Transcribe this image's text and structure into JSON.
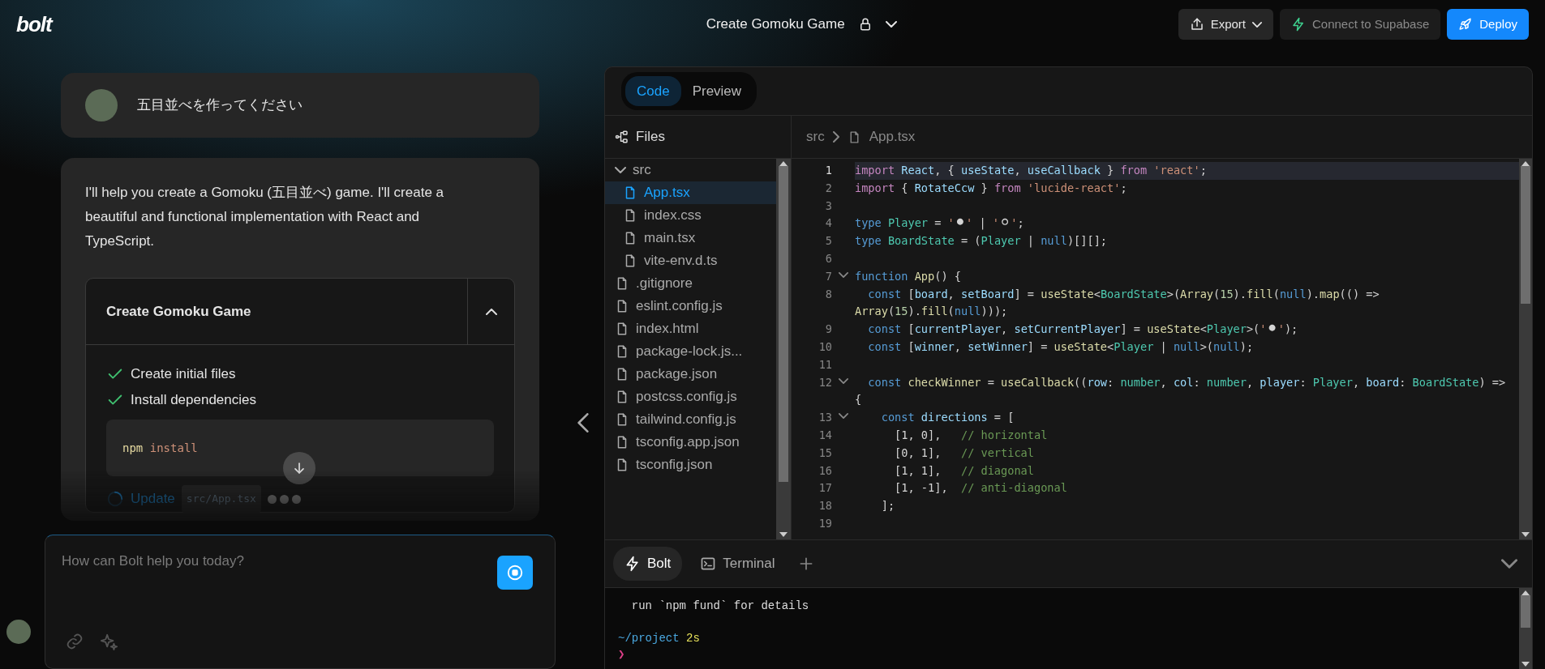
{
  "header": {
    "logo": "bolt",
    "title": "Create Gomoku Game",
    "buttons": [
      {
        "kind": "export",
        "label": "Export",
        "disabled": false
      },
      {
        "kind": "supabase",
        "label": "Connect to Supabase",
        "disabled": true
      },
      {
        "kind": "deploy",
        "label": "Deploy",
        "disabled": false
      }
    ]
  },
  "chat": {
    "messages": [
      {
        "kind": "user",
        "text": "五目並べを作ってください"
      },
      {
        "kind": "assistant",
        "text": "I'll help you create a Gomoku (五目並べ) game. I'll create a beautiful and functional implementation with React and TypeScript.",
        "artifact": {
          "title": "Create Gomoku Game",
          "expanded": true,
          "steps": [
            {
              "kind": "done",
              "label": "Create initial files"
            },
            {
              "kind": "done",
              "label": "Install dependencies",
              "command": [
                "npm",
                "install"
              ]
            },
            {
              "kind": "running",
              "label": "Update",
              "file": "src/App.tsx"
            }
          ]
        }
      }
    ],
    "input": {
      "placeholder": "How can Bolt help you today?"
    }
  },
  "editor": {
    "tabs": [
      {
        "label": "Code",
        "selected": true
      },
      {
        "label": "Preview",
        "selected": false
      }
    ],
    "files_title": "Files",
    "tree": [
      {
        "kind": "folder",
        "name": "src",
        "expanded": true,
        "selected": false,
        "children": [
          {
            "kind": "file",
            "name": "App.tsx",
            "selected": true
          },
          {
            "kind": "file",
            "name": "index.css",
            "selected": false
          },
          {
            "kind": "file",
            "name": "main.tsx",
            "selected": false
          },
          {
            "kind": "file",
            "name": "vite-env.d.ts",
            "selected": false
          }
        ]
      },
      {
        "kind": "file",
        "name": ".gitignore",
        "selected": false
      },
      {
        "kind": "file",
        "name": "eslint.config.js",
        "selected": false
      },
      {
        "kind": "file",
        "name": "index.html",
        "selected": false
      },
      {
        "kind": "file",
        "name": "package-lock.js...",
        "selected": false
      },
      {
        "kind": "file",
        "name": "package.json",
        "selected": false
      },
      {
        "kind": "file",
        "name": "postcss.config.js",
        "selected": false
      },
      {
        "kind": "file",
        "name": "tailwind.config.js",
        "selected": false
      },
      {
        "kind": "file",
        "name": "tsconfig.app.json",
        "selected": false
      },
      {
        "kind": "file",
        "name": "tsconfig.json",
        "selected": false
      }
    ],
    "breadcrumb": [
      "src",
      "App.tsx"
    ],
    "lines": [
      {
        "number": "1",
        "active": true,
        "foldable": false,
        "tokens": [
          {
            "kind": "control",
            "text": "import "
          },
          {
            "kind": "var",
            "text": "React"
          },
          {
            "kind": "plain",
            "text": ", { "
          },
          {
            "kind": "var",
            "text": "useState"
          },
          {
            "kind": "plain",
            "text": ", "
          },
          {
            "kind": "var",
            "text": "useCallback"
          },
          {
            "kind": "plain",
            "text": " } "
          },
          {
            "kind": "control",
            "text": "from "
          },
          {
            "kind": "string",
            "text": "'react'"
          },
          {
            "kind": "plain",
            "text": ";"
          }
        ]
      },
      {
        "number": "2",
        "active": false,
        "foldable": false,
        "tokens": [
          {
            "kind": "control",
            "text": "import"
          },
          {
            "kind": "plain",
            "text": " { "
          },
          {
            "kind": "var",
            "text": "RotateCcw"
          },
          {
            "kind": "plain",
            "text": " } "
          },
          {
            "kind": "control",
            "text": "from "
          },
          {
            "kind": "string",
            "text": "'lucide-react'"
          },
          {
            "kind": "plain",
            "text": ";"
          }
        ]
      },
      {
        "number": "3",
        "active": false,
        "foldable": false
      },
      {
        "number": "4",
        "active": false,
        "foldable": false,
        "tokens": [
          {
            "kind": "keyword",
            "text": "type "
          },
          {
            "kind": "type",
            "text": "Player"
          },
          {
            "kind": "plain",
            "text": " = "
          },
          {
            "kind": "string",
            "text": "'"
          },
          {
            "kind": "stone",
            "text": "⚫"
          },
          {
            "kind": "string",
            "text": "'"
          },
          {
            "kind": "plain",
            "text": " | "
          },
          {
            "kind": "string",
            "text": "'"
          },
          {
            "kind": "stone",
            "text": "⚪"
          },
          {
            "kind": "string",
            "text": "'"
          },
          {
            "kind": "plain",
            "text": ";"
          }
        ]
      },
      {
        "number": "5",
        "active": false,
        "foldable": false,
        "tokens": [
          {
            "kind": "keyword",
            "text": "type "
          },
          {
            "kind": "type",
            "text": "BoardState"
          },
          {
            "kind": "plain",
            "text": " = ("
          },
          {
            "kind": "type",
            "text": "Player"
          },
          {
            "kind": "plain",
            "text": " | "
          },
          {
            "kind": "keyword",
            "text": "null"
          },
          {
            "kind": "plain",
            "text": ")[][];"
          }
        ]
      },
      {
        "number": "6",
        "active": false,
        "foldable": false
      },
      {
        "number": "7",
        "active": false,
        "foldable": true,
        "tokens": [
          {
            "kind": "keyword",
            "text": "function "
          },
          {
            "kind": "func",
            "text": "App"
          },
          {
            "kind": "plain",
            "text": "() {"
          }
        ]
      },
      {
        "number": "8",
        "active": false,
        "foldable": false,
        "tokens": [
          {
            "kind": "keyword",
            "text": "  const"
          },
          {
            "kind": "plain",
            "text": " ["
          },
          {
            "kind": "var",
            "text": "board"
          },
          {
            "kind": "plain",
            "text": ", "
          },
          {
            "kind": "var",
            "text": "setBoard"
          },
          {
            "kind": "plain",
            "text": "] = "
          },
          {
            "kind": "func",
            "text": "useState"
          },
          {
            "kind": "plain",
            "text": "<"
          },
          {
            "kind": "type",
            "text": "BoardState"
          },
          {
            "kind": "plain",
            "text": ">("
          },
          {
            "kind": "func",
            "text": "Array"
          },
          {
            "kind": "plain",
            "text": "("
          },
          {
            "kind": "number",
            "text": "15"
          },
          {
            "kind": "plain",
            "text": ")."
          },
          {
            "kind": "func",
            "text": "fill"
          },
          {
            "kind": "plain",
            "text": "("
          },
          {
            "kind": "keyword",
            "text": "null"
          },
          {
            "kind": "plain",
            "text": ")."
          },
          {
            "kind": "func",
            "text": "map"
          },
          {
            "kind": "plain",
            "text": "(() =>"
          }
        ],
        "wrapped": [
          {
            "kind": "func",
            "text": "Array"
          },
          {
            "kind": "plain",
            "text": "("
          },
          {
            "kind": "number",
            "text": "15"
          },
          {
            "kind": "plain",
            "text": ")."
          },
          {
            "kind": "func",
            "text": "fill"
          },
          {
            "kind": "plain",
            "text": "("
          },
          {
            "kind": "keyword",
            "text": "null"
          },
          {
            "kind": "plain",
            "text": ")));"
          }
        ]
      },
      {
        "number": "9",
        "active": false,
        "foldable": false,
        "tokens": [
          {
            "kind": "keyword",
            "text": "  const"
          },
          {
            "kind": "plain",
            "text": " ["
          },
          {
            "kind": "var",
            "text": "currentPlayer"
          },
          {
            "kind": "plain",
            "text": ", "
          },
          {
            "kind": "var",
            "text": "setCurrentPlayer"
          },
          {
            "kind": "plain",
            "text": "] = "
          },
          {
            "kind": "func",
            "text": "useState"
          },
          {
            "kind": "plain",
            "text": "<"
          },
          {
            "kind": "type",
            "text": "Player"
          },
          {
            "kind": "plain",
            "text": ">("
          },
          {
            "kind": "string",
            "text": "'"
          },
          {
            "kind": "stone",
            "text": "⚫"
          },
          {
            "kind": "string",
            "text": "'"
          },
          {
            "kind": "plain",
            "text": ");"
          }
        ]
      },
      {
        "number": "10",
        "active": false,
        "foldable": false,
        "tokens": [
          {
            "kind": "keyword",
            "text": "  const"
          },
          {
            "kind": "plain",
            "text": " ["
          },
          {
            "kind": "var",
            "text": "winner"
          },
          {
            "kind": "plain",
            "text": ", "
          },
          {
            "kind": "var",
            "text": "setWinner"
          },
          {
            "kind": "plain",
            "text": "] = "
          },
          {
            "kind": "func",
            "text": "useState"
          },
          {
            "kind": "plain",
            "text": "<"
          },
          {
            "kind": "type",
            "text": "Player"
          },
          {
            "kind": "plain",
            "text": " | "
          },
          {
            "kind": "keyword",
            "text": "null"
          },
          {
            "kind": "plain",
            "text": ">("
          },
          {
            "kind": "keyword",
            "text": "null"
          },
          {
            "kind": "plain",
            "text": ");"
          }
        ]
      },
      {
        "number": "11",
        "active": false,
        "foldable": false
      },
      {
        "number": "12",
        "active": false,
        "foldable": true,
        "tokens": [
          {
            "kind": "keyword",
            "text": "  const "
          },
          {
            "kind": "func",
            "text": "checkWinner"
          },
          {
            "kind": "plain",
            "text": " = "
          },
          {
            "kind": "func",
            "text": "useCallback"
          },
          {
            "kind": "plain",
            "text": "(("
          },
          {
            "kind": "var",
            "text": "row"
          },
          {
            "kind": "plain",
            "text": ": "
          },
          {
            "kind": "type",
            "text": "number"
          },
          {
            "kind": "plain",
            "text": ", "
          },
          {
            "kind": "var",
            "text": "col"
          },
          {
            "kind": "plain",
            "text": ": "
          },
          {
            "kind": "type",
            "text": "number"
          },
          {
            "kind": "plain",
            "text": ", "
          },
          {
            "kind": "var",
            "text": "player"
          },
          {
            "kind": "plain",
            "text": ": "
          },
          {
            "kind": "type",
            "text": "Player"
          },
          {
            "kind": "plain",
            "text": ", "
          },
          {
            "kind": "var",
            "text": "board"
          },
          {
            "kind": "plain",
            "text": ": "
          },
          {
            "kind": "type",
            "text": "BoardState"
          },
          {
            "kind": "plain",
            "text": ") =>"
          }
        ],
        "wrapped": [
          {
            "kind": "plain",
            "text": "{"
          }
        ]
      },
      {
        "number": "13",
        "active": false,
        "foldable": true,
        "tokens": [
          {
            "kind": "keyword",
            "text": "    const "
          },
          {
            "kind": "var",
            "text": "directions"
          },
          {
            "kind": "plain",
            "text": " = ["
          }
        ]
      },
      {
        "number": "14",
        "active": false,
        "foldable": false,
        "tokens": [
          {
            "kind": "plain",
            "text": "      [1, 0],   "
          },
          {
            "kind": "comment",
            "text": "// horizontal"
          }
        ]
      },
      {
        "number": "15",
        "active": false,
        "foldable": false,
        "tokens": [
          {
            "kind": "plain",
            "text": "      [0, 1],   "
          },
          {
            "kind": "comment",
            "text": "// vertical"
          }
        ]
      },
      {
        "number": "16",
        "active": false,
        "foldable": false,
        "tokens": [
          {
            "kind": "plain",
            "text": "      [1, 1],   "
          },
          {
            "kind": "comment",
            "text": "// diagonal"
          }
        ]
      },
      {
        "number": "17",
        "active": false,
        "foldable": false,
        "tokens": [
          {
            "kind": "plain",
            "text": "      [1, -1],  "
          },
          {
            "kind": "comment",
            "text": "// anti-diagonal"
          }
        ]
      },
      {
        "number": "18",
        "active": false,
        "foldable": false,
        "tokens": [
          {
            "kind": "plain",
            "text": "    ];"
          }
        ]
      },
      {
        "number": "19",
        "active": false,
        "foldable": false
      }
    ],
    "terminal_tabs": [
      {
        "kind": "bolt",
        "label": "Bolt",
        "selected": true
      },
      {
        "kind": "terminal",
        "label": "Terminal",
        "selected": false
      }
    ],
    "terminal_lines": [
      {
        "kind": "output",
        "text": "  run `npm fund` for details"
      },
      {
        "kind": "blank"
      },
      {
        "kind": "prompt",
        "path": "~/project",
        "time": "2s",
        "symbol": "❯"
      }
    ]
  }
}
